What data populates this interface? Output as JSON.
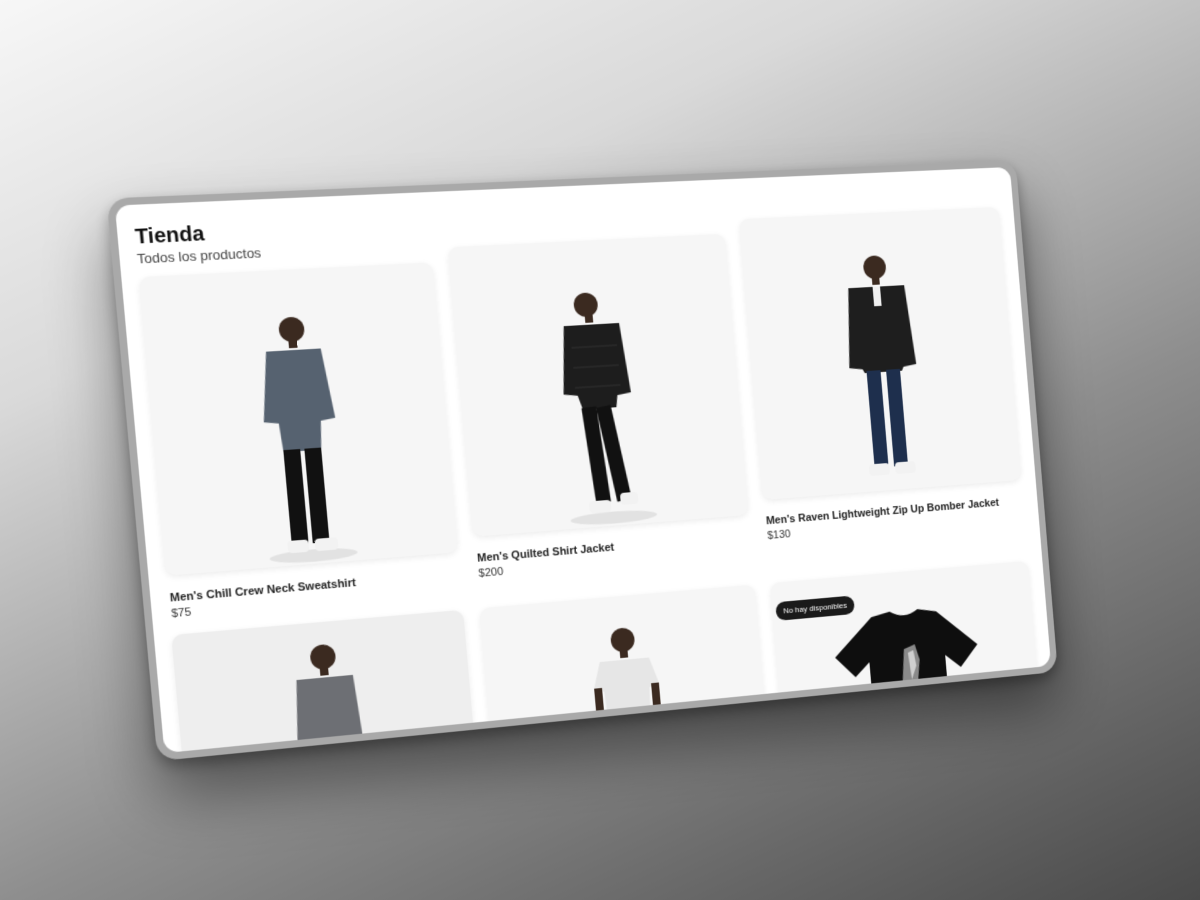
{
  "store": {
    "title": "Tienda",
    "subtitle": "Todos los productos"
  },
  "products": [
    {
      "name": "Men's Chill Crew Neck Sweatshirt",
      "price": "$75",
      "image": "model-grey-sweatshirt"
    },
    {
      "name": "Men's Quilted Shirt Jacket",
      "price": "$200",
      "image": "model-black-quilted-jacket"
    },
    {
      "name": "Men's Raven Lightweight Zip Up Bomber Jacket",
      "price": "$130",
      "image": "model-black-bomber-jacket"
    },
    {
      "name": "",
      "price": "",
      "image": "model-grey-long-sleeve"
    },
    {
      "name": "",
      "price": "",
      "image": "model-white-tee"
    },
    {
      "name": "",
      "price": "",
      "image": "black-tee-raven-print",
      "badge": "No hay disponibles"
    }
  ],
  "colors": {
    "card_bg": "#f6f6f6",
    "badge_bg": "#1a1a1a",
    "text": "#111111"
  }
}
